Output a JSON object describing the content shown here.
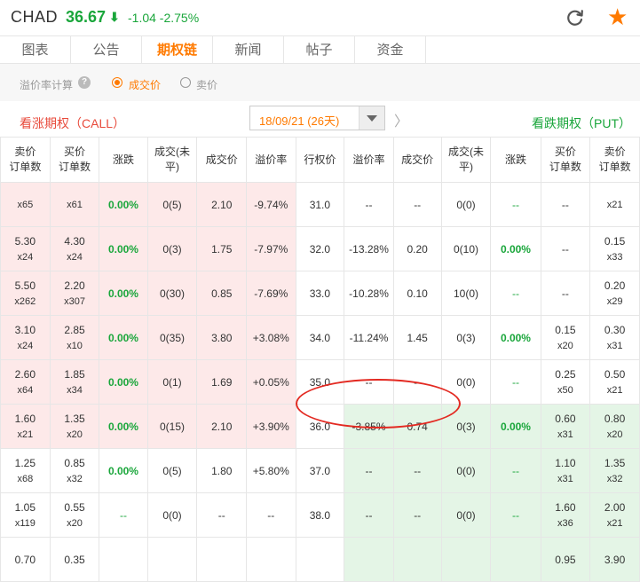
{
  "header": {
    "symbol": "CHAD",
    "price": "36.67",
    "arrow": "⬇",
    "change": "-1.04  -2.75%"
  },
  "icons": {
    "refresh": "refresh-icon",
    "star": "star-icon"
  },
  "tabs": [
    {
      "label": "图表"
    },
    {
      "label": "公告"
    },
    {
      "label": "期权链",
      "active": true
    },
    {
      "label": "新闻"
    },
    {
      "label": "帖子"
    },
    {
      "label": "资金"
    }
  ],
  "premium": {
    "label": "溢价率计算",
    "help": "?",
    "options": [
      "成交价",
      "卖价"
    ],
    "selected": "成交价"
  },
  "chain": {
    "call_label": "看涨期权（CALL）",
    "put_label": "看跌期权（PUT）",
    "expiry": "18/09/21 (26天)"
  },
  "columns": [
    "卖价\n订单数",
    "买价\n订单数",
    "涨跌",
    "成交(未平)",
    "成交价",
    "溢价率",
    "行权价",
    "溢价率",
    "成交价",
    "成交(未平)",
    "涨跌",
    "买价\n订单数",
    "卖价\n订单数"
  ],
  "rows": [
    {
      "call": {
        "ask": "",
        "ask_sz": "x65",
        "bid": "",
        "bid_sz": "x61",
        "chg": "0.00%",
        "vol": "0(5)",
        "last": "2.10",
        "prem": "-9.74%"
      },
      "strike": "31.0",
      "put": {
        "prem": "--",
        "last": "--",
        "vol": "0(0)",
        "chg": "--",
        "bid": "--",
        "bid_sz": "",
        "ask": "",
        "ask_sz": "x21"
      }
    },
    {
      "call": {
        "ask": "5.30",
        "ask_sz": "x24",
        "bid": "4.30",
        "bid_sz": "x24",
        "chg": "0.00%",
        "vol": "0(3)",
        "last": "1.75",
        "prem": "-7.97%"
      },
      "strike": "32.0",
      "put": {
        "prem": "-13.28%",
        "last": "0.20",
        "vol": "0(10)",
        "chg": "0.00%",
        "bid": "--",
        "bid_sz": "",
        "ask": "0.15",
        "ask_sz": "x33"
      }
    },
    {
      "call": {
        "ask": "5.50",
        "ask_sz": "x262",
        "bid": "2.20",
        "bid_sz": "x307",
        "chg": "0.00%",
        "vol": "0(30)",
        "last": "0.85",
        "prem": "-7.69%"
      },
      "strike": "33.0",
      "put": {
        "prem": "-10.28%",
        "last": "0.10",
        "vol": "10(0)",
        "chg": "--",
        "bid": "--",
        "bid_sz": "",
        "ask": "0.20",
        "ask_sz": "x29"
      }
    },
    {
      "call": {
        "ask": "3.10",
        "ask_sz": "x24",
        "bid": "2.85",
        "bid_sz": "x10",
        "chg": "0.00%",
        "vol": "0(35)",
        "last": "3.80",
        "prem": "+3.08%"
      },
      "strike": "34.0",
      "put": {
        "prem": "-11.24%",
        "last": "1.45",
        "vol": "0(3)",
        "chg": "0.00%",
        "bid": "0.15",
        "bid_sz": "x20",
        "ask": "0.30",
        "ask_sz": "x31"
      }
    },
    {
      "call": {
        "ask": "2.60",
        "ask_sz": "x64",
        "bid": "1.85",
        "bid_sz": "x34",
        "chg": "0.00%",
        "vol": "0(1)",
        "last": "1.69",
        "prem": "+0.05%"
      },
      "strike": "35.0",
      "put": {
        "prem": "--",
        "last": "--",
        "vol": "0(0)",
        "chg": "--",
        "bid": "0.25",
        "bid_sz": "x50",
        "ask": "0.50",
        "ask_sz": "x21"
      }
    },
    {
      "call": {
        "ask": "1.60",
        "ask_sz": "x21",
        "bid": "1.35",
        "bid_sz": "x20",
        "chg": "0.00%",
        "vol": "0(15)",
        "last": "2.10",
        "prem": "+3.90%"
      },
      "strike": "36.0",
      "put": {
        "prem": "-3.85%",
        "last": "0.74",
        "vol": "0(3)",
        "chg": "0.00%",
        "bid": "0.60",
        "bid_sz": "x31",
        "ask": "0.80",
        "ask_sz": "x20"
      }
    },
    {
      "call": {
        "ask": "1.25",
        "ask_sz": "x68",
        "bid": "0.85",
        "bid_sz": "x32",
        "chg": "0.00%",
        "vol": "0(5)",
        "last": "1.80",
        "prem": "+5.80%"
      },
      "strike": "37.0",
      "put": {
        "prem": "--",
        "last": "--",
        "vol": "0(0)",
        "chg": "--",
        "bid": "1.10",
        "bid_sz": "x31",
        "ask": "1.35",
        "ask_sz": "x32"
      }
    },
    {
      "call": {
        "ask": "1.05",
        "ask_sz": "x119",
        "bid": "0.55",
        "bid_sz": "x20",
        "chg": "--",
        "vol": "0(0)",
        "last": "--",
        "prem": "--"
      },
      "strike": "38.0",
      "put": {
        "prem": "--",
        "last": "--",
        "vol": "0(0)",
        "chg": "--",
        "bid": "1.60",
        "bid_sz": "x36",
        "ask": "2.00",
        "ask_sz": "x21"
      }
    },
    {
      "call": {
        "ask": "0.70",
        "ask_sz": "",
        "bid": "0.35",
        "bid_sz": "",
        "chg": "",
        "vol": "",
        "last": "",
        "prem": ""
      },
      "strike": "",
      "put": {
        "prem": "",
        "last": "",
        "vol": "",
        "chg": "",
        "bid": "0.95",
        "bid_sz": "",
        "ask": "3.90",
        "ask_sz": ""
      }
    }
  ],
  "colors": {
    "up": "#e84a3b",
    "down": "#1aa63b",
    "accent": "#ff7a00",
    "itm_call": "#fde9e9",
    "itm_put": "#e4f5e6"
  }
}
